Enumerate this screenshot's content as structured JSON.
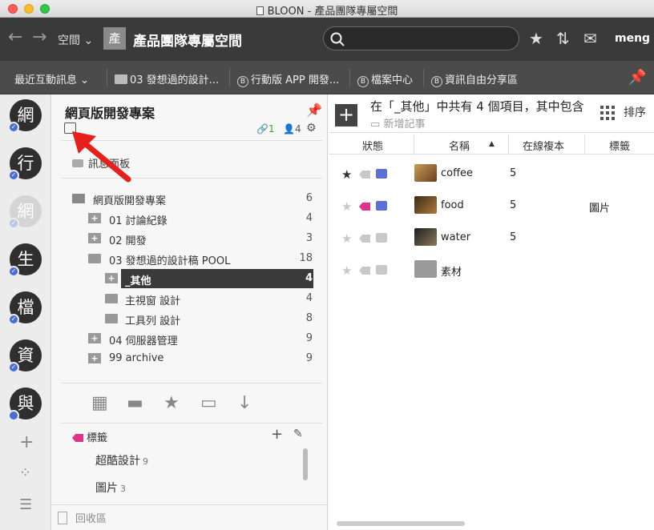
{
  "window": {
    "title": "BLOON - 產品團隊專屬空間"
  },
  "topbar": {
    "space_label": "空間",
    "space_icon": "產",
    "space_title": "產品團隊專屬空間",
    "user": "meng"
  },
  "shortcuts": [
    {
      "label": "最近互動訊息",
      "icon": "chevron-down"
    },
    {
      "label": "03 發想過的設計...",
      "icon": "folder"
    },
    {
      "label": "行動版 APP 開發...",
      "icon": "bloon-circle"
    },
    {
      "label": "檔案中心",
      "icon": "bloon-circle"
    },
    {
      "label": "資訊自由分享區",
      "icon": "bloon-circle"
    }
  ],
  "rail": [
    {
      "char": "網",
      "dim": false
    },
    {
      "char": "行",
      "dim": false
    },
    {
      "char": "網",
      "dim": true
    },
    {
      "char": "生",
      "dim": false
    },
    {
      "char": "檔",
      "dim": false
    },
    {
      "char": "資",
      "dim": false
    },
    {
      "char": "與",
      "dim": false
    }
  ],
  "panel": {
    "title": "網頁版開發專案",
    "link_count": "1",
    "member_count": "4",
    "message_board": "訊息面板",
    "tree": [
      {
        "label": "網頁版開發專案",
        "count": "6"
      },
      {
        "label": "01 討論紀錄",
        "count": "4"
      },
      {
        "label": "02 開發",
        "count": "3"
      },
      {
        "label": "03 發想過的設計稿 POOL",
        "count": "18"
      },
      {
        "label": "_其他",
        "count": "4"
      },
      {
        "label": "主視窗 設計",
        "count": "4"
      },
      {
        "label": "工具列 設計",
        "count": "8"
      },
      {
        "label": "04 伺服器管理",
        "count": "9"
      },
      {
        "label": "99 archive",
        "count": "9"
      }
    ],
    "tags_title": "標籤",
    "tags": [
      {
        "name": "超酷設計",
        "count": "9"
      },
      {
        "name": "圖片",
        "count": "3"
      }
    ],
    "recycle": "回收區"
  },
  "main": {
    "header": "在「_其他」中共有 4 個項目，其中包含",
    "new_note": "新增記事",
    "sort_label": "排序",
    "columns": [
      "狀態",
      "名稱",
      "在線複本",
      "標籤"
    ],
    "rows": [
      {
        "name": "coffee",
        "copies": "5",
        "tag": "",
        "starred": true,
        "tagged": false,
        "comment": true
      },
      {
        "name": "food",
        "copies": "5",
        "tag": "圖片",
        "starred": false,
        "tagged": true,
        "comment": true
      },
      {
        "name": "water",
        "copies": "5",
        "tag": "",
        "starred": false,
        "tagged": false,
        "comment": false
      },
      {
        "name": "素材",
        "copies": "",
        "tag": "",
        "starred": false,
        "tagged": false,
        "comment": false
      }
    ]
  },
  "colors": {
    "accent": "#4a6cd4",
    "tag_pink": "#e0348a",
    "link_green": "#3aa23a",
    "dark": "#3a3a3a"
  }
}
